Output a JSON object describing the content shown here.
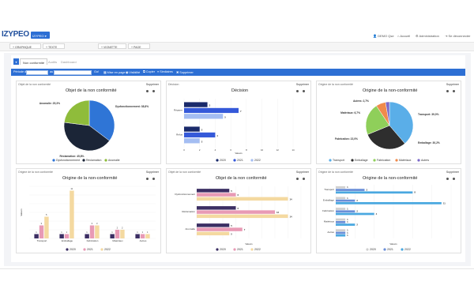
{
  "app": {
    "logo": "IZYPEO",
    "app_select": "IZYPEO",
    "user": "DEMO Qse",
    "home": "Accueil",
    "admin": "Administration",
    "logout": "Se déconnecter"
  },
  "toolbar": {
    "graphique": "+ GRAPHIQUE",
    "texte": "+ TEXTE",
    "vignette": "+ VIGNETTE",
    "page": "+ PAGE"
  },
  "tabs": {
    "active": "Non conformité",
    "t2": "Audits",
    "t3": "Dashboard"
  },
  "filter": {
    "label": "Période du",
    "to": "au",
    "go": "Go!",
    "mise_en_page": "Mise en page",
    "visibilite": "Visibilité",
    "copier": "Copier",
    "similaires": "Similaires",
    "supprimer": "Supprimer"
  },
  "colors": {
    "primary": "#2d6fd4",
    "series_2020": "#3b2e63",
    "series_2021": "#e89ab5",
    "series_2022": "#f4d9a0"
  },
  "cards": {
    "c1": {
      "title": "Objet de la non conformité",
      "heading": "Objet de la non conformité",
      "delete": "Supprimer",
      "chart_data": {
        "type": "pie",
        "categories": [
          "Dysfonctionnement",
          "Réclamation",
          "Anomalie"
        ],
        "values": [
          38.8,
          45.8,
          25.3
        ],
        "labels": [
          "Dysfonctionnement: 38,8%",
          "Réclamation: 45,8%",
          "Anomalie: 25,3%"
        ],
        "colors": [
          "#2f75d6",
          "#1b2537",
          "#8fbc3b"
        ]
      }
    },
    "c2": {
      "title": "Décision",
      "heading": "Décision",
      "delete": "Supprimer",
      "chart_data": {
        "type": "bar",
        "orientation": "horizontal",
        "categories": [
          "Réparer",
          "Refus"
        ],
        "series": [
          {
            "name": "2020",
            "values": [
              3,
              2
            ]
          },
          {
            "name": "2021",
            "values": [
              7,
              4
            ]
          },
          {
            "name": "2022",
            "values": [
              5,
              2
            ]
          }
        ],
        "xticks": [
          "0",
          "2",
          "4",
          "6",
          "8",
          "10",
          "12",
          "14"
        ],
        "xlabel": "Valeurs",
        "xlim": [
          0,
          14
        ]
      }
    },
    "c3": {
      "title": "Origine de la non conformité",
      "heading": "Origine de la non-conformité",
      "delete": "Supprimer",
      "chart_data": {
        "type": "pie",
        "categories": [
          "Transport",
          "Emballage",
          "Fabrication",
          "Matériaux",
          "Autres"
        ],
        "values": [
          39.0,
          30.2,
          22.0,
          6.7,
          2.7
        ],
        "labels": [
          "Transport: 39,0%",
          "Emballage: 30,2%",
          "Fabrication: 22,0%",
          "Matériaux: 6,7%",
          "Autres: 2,7%"
        ],
        "colors": [
          "#5aaee8",
          "#2e2e2e",
          "#8fcf5a",
          "#f08a4b",
          "#7b68c8"
        ]
      }
    },
    "c4": {
      "title": "Origine de la non conformité",
      "heading": "Origine de la non-conformité",
      "delete": "Supprimer",
      "chart_data": {
        "type": "bar",
        "orientation": "vertical",
        "categories": [
          "Transport",
          "Emballage",
          "Fabrication",
          "Matériaux",
          "Autres"
        ],
        "series": [
          {
            "name": "2020",
            "values": [
              1,
              1,
              1,
              1,
              1
            ]
          },
          {
            "name": "2021",
            "values": [
              3,
              1,
              3,
              2,
              1
            ]
          },
          {
            "name": "2022",
            "values": [
              5,
              11,
              3,
              2,
              1
            ]
          }
        ],
        "ylabel": "Valeurs",
        "ylim": [
          0,
          12
        ]
      }
    },
    "c5": {
      "title": "Objet de la non conformité",
      "heading": "Objet de la non conformité",
      "delete": "Supprimer",
      "chart_data": {
        "type": "bar",
        "orientation": "horizontal",
        "categories": [
          "Dysfonctionnement",
          "Réclamation",
          "Anomalie"
        ],
        "series": [
          {
            "name": "2020",
            "values": [
              5,
              6,
              5
            ]
          },
          {
            "name": "2021",
            "values": [
              6,
              12,
              7
            ]
          },
          {
            "name": "2022",
            "values": [
              14,
              14,
              5
            ]
          }
        ],
        "xlabel": "Valeurs",
        "xlim": [
          0,
          16
        ]
      }
    },
    "c6": {
      "title": "Origine de la non conformité",
      "heading": "Origine de la non-conformité",
      "delete": "Supprimer",
      "chart_data": {
        "type": "bar",
        "orientation": "horizontal",
        "categories": [
          "Transport",
          "Emballage",
          "Fabrication",
          "Matériaux",
          "Autres"
        ],
        "series": [
          {
            "name": "2020",
            "values": [
              1,
              1,
              1,
              1,
              1
            ]
          },
          {
            "name": "2021",
            "values": [
              3,
              2,
              2,
              1,
              1
            ]
          },
          {
            "name": "2022",
            "values": [
              8,
              11,
              4,
              2,
              1
            ]
          }
        ],
        "xlabel": "Valeurs",
        "xlim": [
          0,
          12
        ]
      }
    }
  },
  "legend_years": [
    "2020",
    "2021",
    "2022"
  ]
}
